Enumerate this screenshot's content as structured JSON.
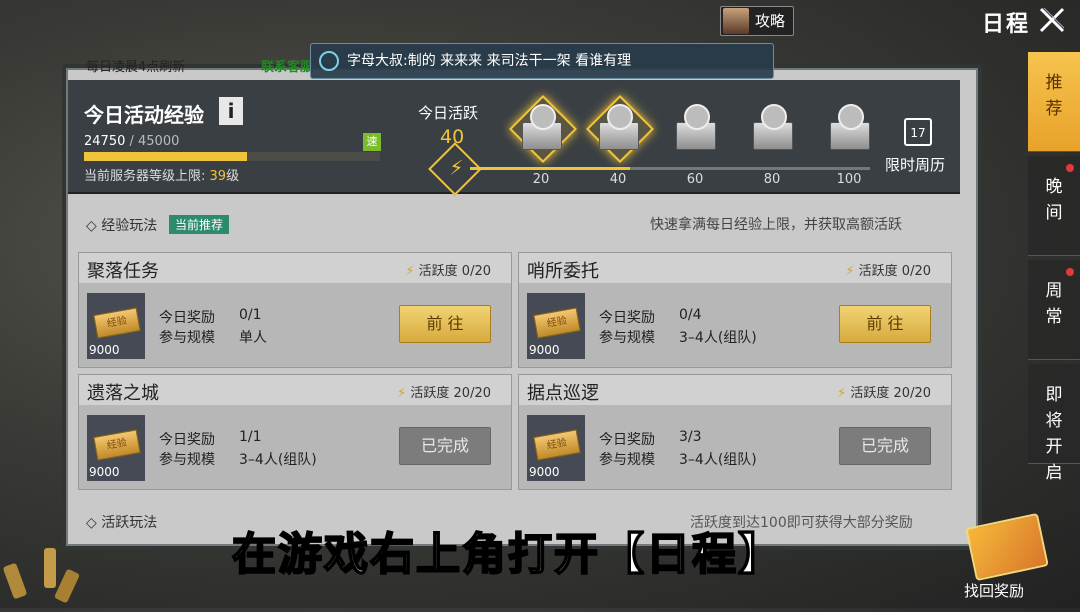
{
  "header": {
    "guide_label": "攻略",
    "title": "日程"
  },
  "board": {
    "refresh_note": "每日凌晨4点刷新",
    "service_link": "联系客服",
    "chat_message": "字母大叔:制的   来来来   来司法干一架   看谁有理"
  },
  "exp": {
    "title": "今日活动经验",
    "info_label": "i",
    "current": "24750",
    "separator": " / ",
    "max": "45000",
    "fill_fraction": 0.55,
    "speed_badge": "速",
    "server_cap_prefix": "当前服务器等级上限: ",
    "server_cap_level": "39",
    "server_cap_suffix": "级"
  },
  "activity": {
    "label": "今日活跃",
    "value": "40",
    "progress_fraction": 0.4,
    "milestones": [
      "20",
      "40",
      "60",
      "80",
      "100"
    ],
    "weekly_label": "限时周历",
    "calendar_day": "17"
  },
  "exp_section": {
    "title": "经验玩法",
    "tag": "当前推荐",
    "desc": "快速拿满每日经验上限，并获取高额活跃"
  },
  "cards": [
    {
      "name": "聚落任务",
      "act_label": "活跃度",
      "act_value": "0/20",
      "reward_label": "今日奖励",
      "reward_value": "0/1",
      "scale_label": "参与规模",
      "scale_value": "单人",
      "ticket": "经验",
      "amount": "9000",
      "button": "前 往",
      "state": "go"
    },
    {
      "name": "哨所委托",
      "act_label": "活跃度",
      "act_value": "0/20",
      "reward_label": "今日奖励",
      "reward_value": "0/4",
      "scale_label": "参与规模",
      "scale_value": "3–4人(组队)",
      "ticket": "经验",
      "amount": "9000",
      "button": "前 往",
      "state": "go"
    },
    {
      "name": "遗落之城",
      "act_label": "活跃度",
      "act_value": "20/20",
      "reward_label": "今日奖励",
      "reward_value": "1/1",
      "scale_label": "参与规模",
      "scale_value": "3–4人(组队)",
      "ticket": "经验",
      "amount": "9000",
      "button": "已完成",
      "state": "done"
    },
    {
      "name": "据点巡逻",
      "act_label": "活跃度",
      "act_value": "20/20",
      "reward_label": "今日奖励",
      "reward_value": "3/3",
      "scale_label": "参与规模",
      "scale_value": "3–4人(组队)",
      "ticket": "经验",
      "amount": "9000",
      "button": "已完成",
      "state": "done"
    }
  ],
  "act_section": {
    "title": "活跃玩法",
    "desc": "活跃度到达100即可获得大部分奖励"
  },
  "subtitle": "在游戏右上角打开【日程】",
  "tabs": [
    {
      "label": "推荐",
      "active": true,
      "dot": false
    },
    {
      "label": "晚间",
      "active": false,
      "dot": true
    },
    {
      "label": "周常",
      "active": false,
      "dot": true
    },
    {
      "label": "即将开启",
      "active": false,
      "dot": false
    }
  ],
  "reward_button": "找回奖励",
  "colors": {
    "accent": "#f0c43a",
    "panel": "#3a3f44",
    "tab_active": "#f6c44e",
    "service": "#1f8a1f"
  }
}
